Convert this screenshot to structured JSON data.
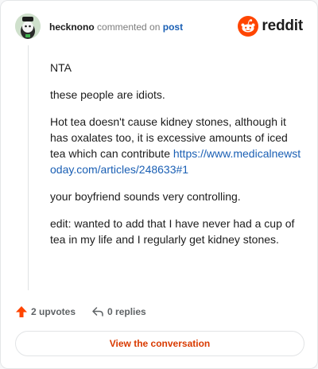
{
  "header": {
    "username": "hecknono",
    "commented_text": "commented on",
    "post_link": "post",
    "brand": "reddit"
  },
  "comment": {
    "paragraphs": [
      "NTA",
      "these people are idiots.",
      "Hot tea doesn't cause kidney stones, although it has oxalates too, it is excessive amounts of iced tea which can contribute",
      "your boyfriend sounds very controlling.",
      "edit: wanted to add that I have never had a cup of tea in my life and I regularly get kidney stones."
    ],
    "link": "https://www.medicalnewstoday.com/articles/248633#1"
  },
  "actions": {
    "upvotes_label": "2 upvotes",
    "replies_label": "0 replies"
  },
  "button": {
    "label": "View the conversation"
  },
  "icons": {
    "upvote": "upvote-arrow-icon",
    "reply": "reply-icon",
    "brand": "reddit-snoo-icon"
  },
  "colors": {
    "accent": "#ff4500",
    "link": "#1a5fb4",
    "button_text": "#d93a00"
  }
}
